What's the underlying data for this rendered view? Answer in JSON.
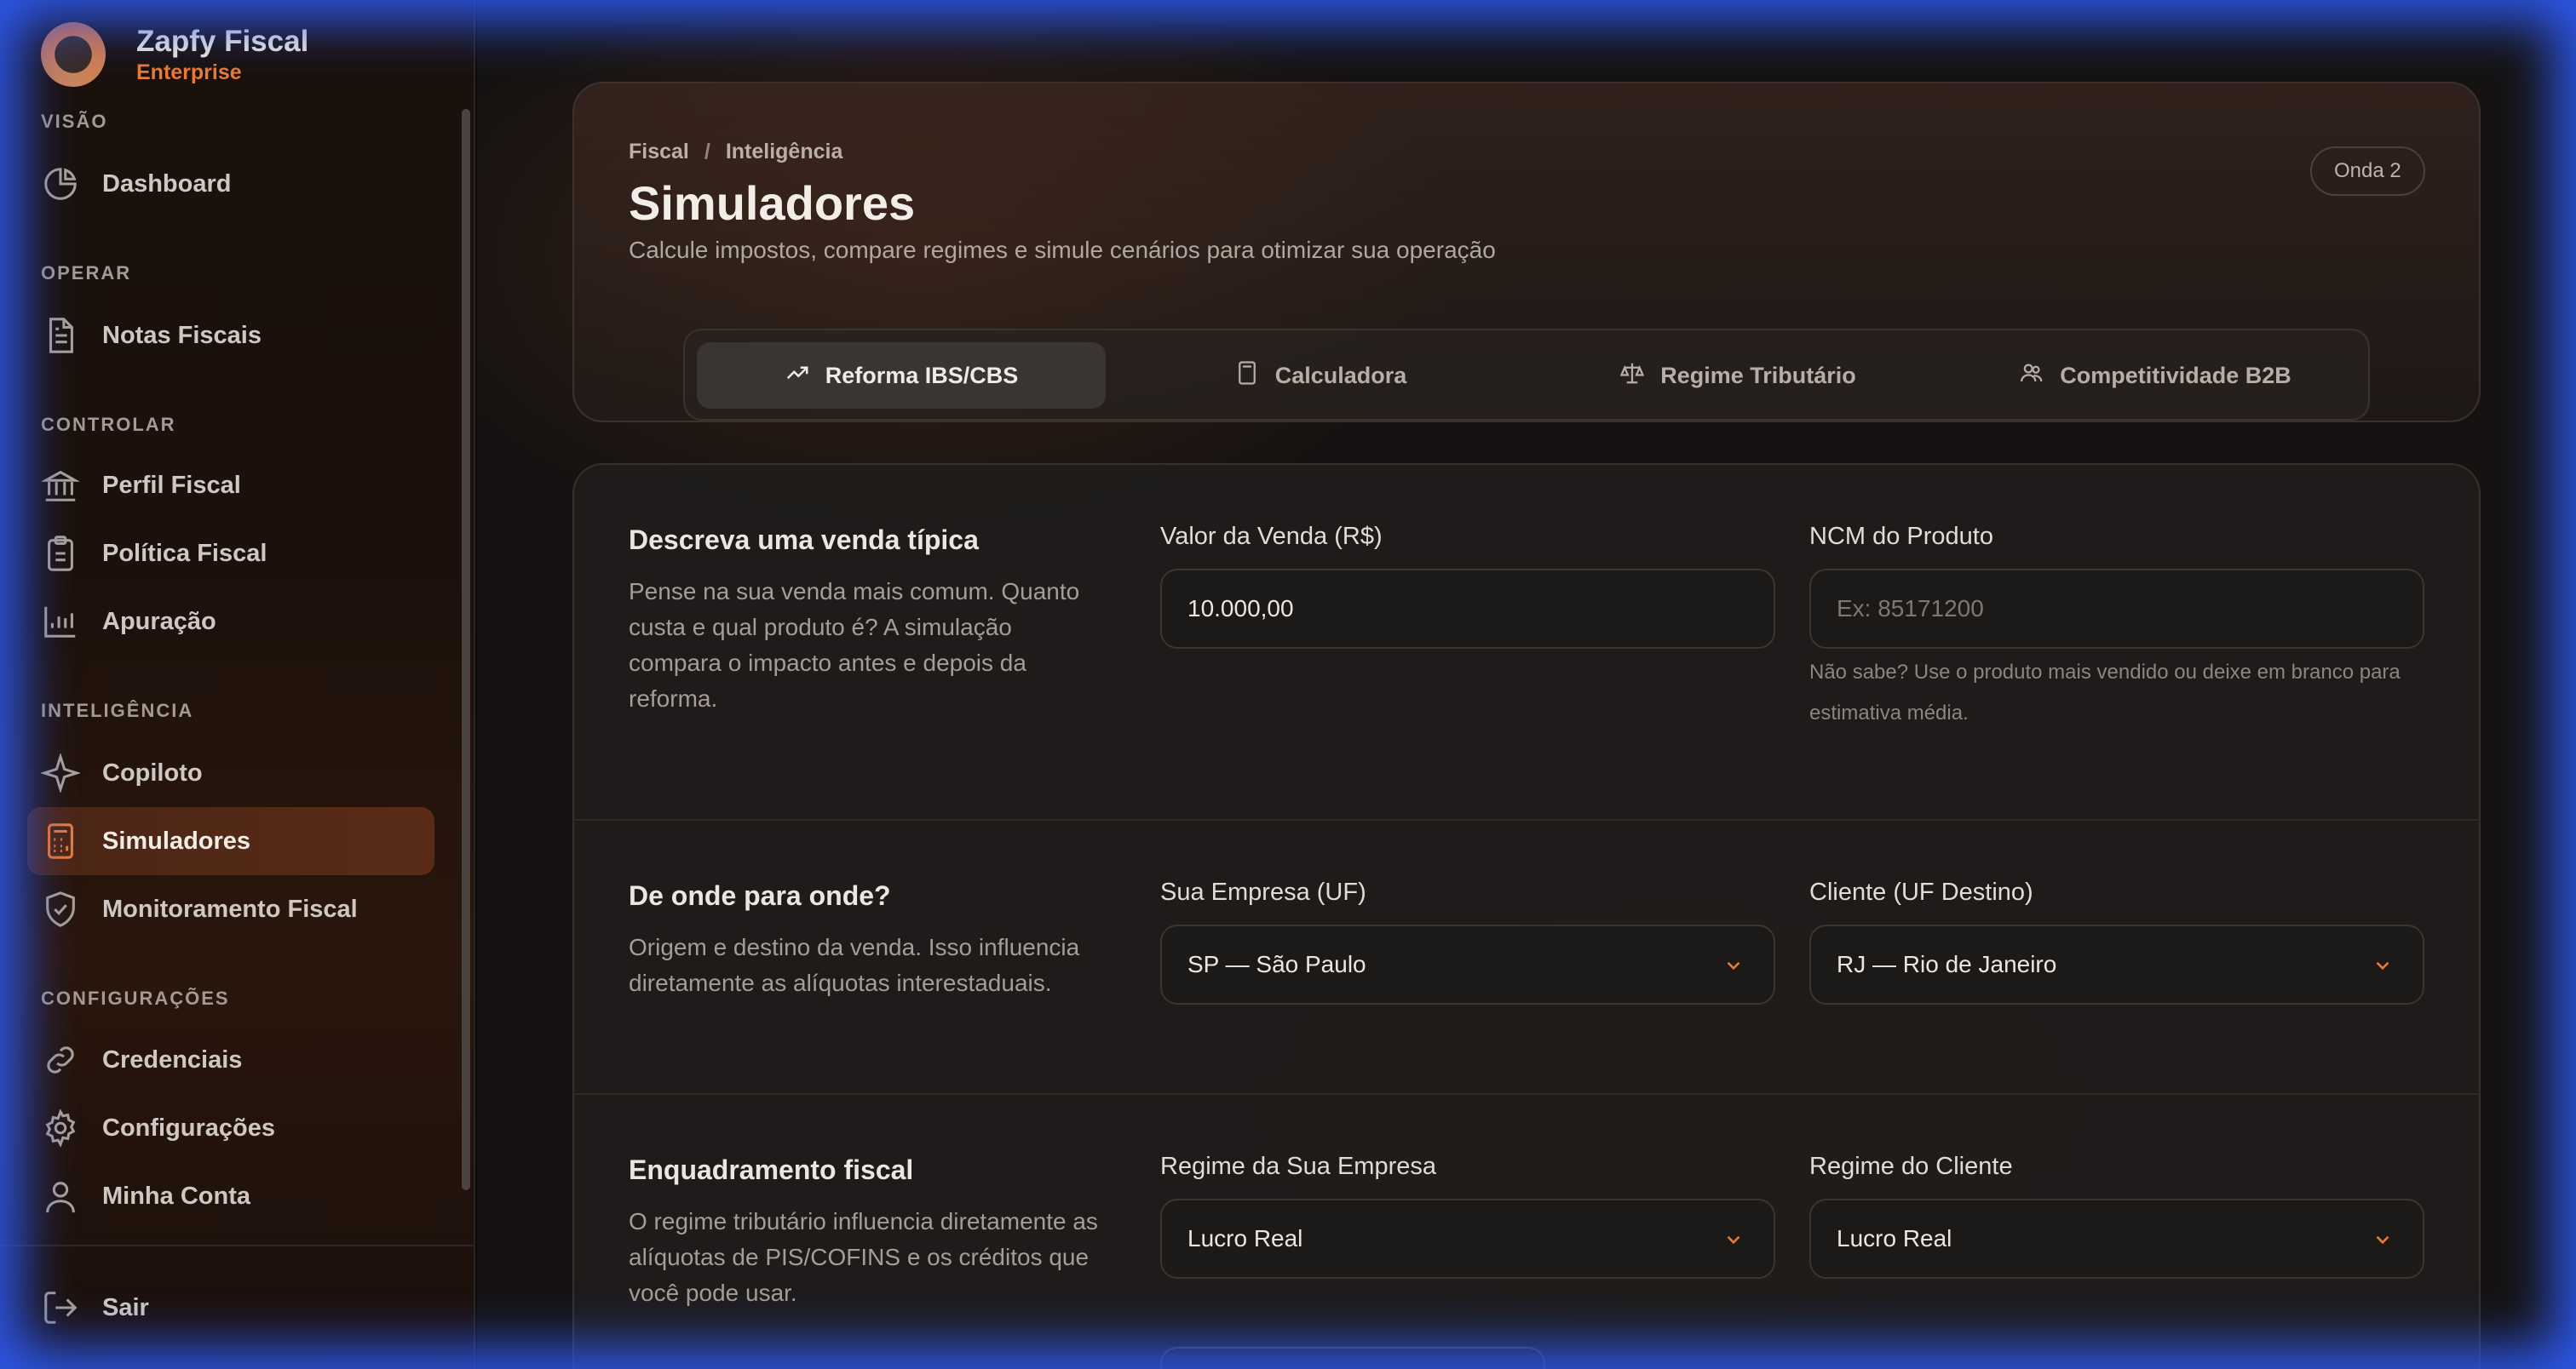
{
  "app": {
    "name": "Zapfy Fiscal",
    "edition": "Enterprise"
  },
  "sidebar": {
    "sections": [
      {
        "label": "VISÃO",
        "items": [
          {
            "label": "Dashboard",
            "icon": "pie-chart-icon"
          }
        ]
      },
      {
        "label": "OPERAR",
        "items": [
          {
            "label": "Notas Fiscais",
            "icon": "document-icon"
          }
        ]
      },
      {
        "label": "CONTROLAR",
        "items": [
          {
            "label": "Perfil Fiscal",
            "icon": "bank-icon"
          },
          {
            "label": "Política Fiscal",
            "icon": "clipboard-icon"
          },
          {
            "label": "Apuração",
            "icon": "bar-chart-icon"
          }
        ]
      },
      {
        "label": "INTELIGÊNCIA",
        "items": [
          {
            "label": "Copiloto",
            "icon": "sparkle-icon"
          },
          {
            "label": "Simuladores",
            "icon": "calculator-icon",
            "active": true
          },
          {
            "label": "Monitoramento Fiscal",
            "icon": "shield-check-icon"
          }
        ]
      },
      {
        "label": "CONFIGURAÇÕES",
        "items": [
          {
            "label": "Credenciais",
            "icon": "link-icon"
          },
          {
            "label": "Configurações",
            "icon": "gear-icon"
          },
          {
            "label": "Minha Conta",
            "icon": "user-icon"
          }
        ]
      }
    ],
    "logout": "Sair"
  },
  "header": {
    "breadcrumb": [
      "Fiscal",
      "Inteligência"
    ],
    "title": "Simuladores",
    "subtitle": "Calcule impostos, compare regimes e simule cenários para otimizar sua operação",
    "badge": "Onda 2"
  },
  "tabs": [
    {
      "label": "Reforma IBS/CBS",
      "icon": "trend-up-icon",
      "active": true
    },
    {
      "label": "Calculadora",
      "icon": "calculator-icon"
    },
    {
      "label": "Regime Tributário",
      "icon": "scale-icon"
    },
    {
      "label": "Competitividade B2B",
      "icon": "users-icon"
    }
  ],
  "form": {
    "s1": {
      "title": "Descreva uma venda típica",
      "desc": "Pense na sua venda mais comum. Quanto custa e qual produto é? A simulação compara o impacto antes e depois da reforma.",
      "valor_label": "Valor da Venda (R$)",
      "valor_value": "10.000,00",
      "ncm_label": "NCM do Produto",
      "ncm_placeholder": "Ex: 85171200",
      "ncm_hint": "Não sabe? Use o produto mais vendido ou deixe em branco para estimativa média."
    },
    "s2": {
      "title": "De onde para onde?",
      "desc": "Origem e destino da venda. Isso influencia diretamente as alíquotas interestaduais.",
      "origem_label": "Sua Empresa (UF)",
      "origem_value": "SP — São Paulo",
      "destino_label": "Cliente (UF Destino)",
      "destino_value": "RJ — Rio de Janeiro"
    },
    "s3": {
      "title": "Enquadramento fiscal",
      "desc": "O regime tributário influencia diretamente as alíquotas de PIS/COFINS e os créditos que você pode usar.",
      "regime_empresa_label": "Regime da Sua Empresa",
      "regime_empresa_value": "Lucro Real",
      "regime_cliente_label": "Regime do Cliente",
      "regime_cliente_value": "Lucro Real"
    }
  },
  "colors": {
    "accent": "#ea7a35",
    "frame": "#2c56e6"
  }
}
